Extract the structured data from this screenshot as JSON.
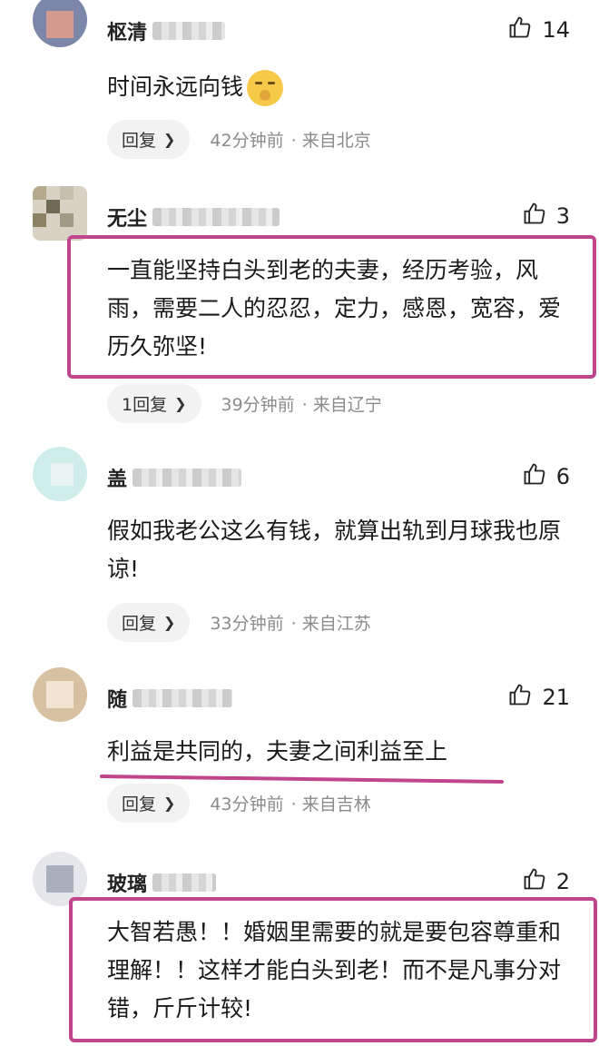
{
  "comments": [
    {
      "name_visible": "枢清",
      "likes": "14",
      "text": "时间永远向钱",
      "emoji": "shushing-face",
      "reply_label": "回复",
      "time": "42分钟前",
      "location": "· 来自北京"
    },
    {
      "name_visible": "无尘",
      "likes": "3",
      "text": "一直能坚持白头到老的夫妻，经历考验，风雨，需要二人的忍忍，定力，感恩，宽容，爱历久弥坚!",
      "reply_label": "1回复",
      "time": "39分钟前",
      "location": "· 来自辽宁"
    },
    {
      "name_visible": "盖",
      "likes": "6",
      "text": "假如我老公这么有钱，就算出轨到月球我也原谅!",
      "reply_label": "回复",
      "time": "33分钟前",
      "location": "· 来自江苏"
    },
    {
      "name_visible": "随",
      "likes": "21",
      "text": "利益是共同的，夫妻之间利益至上",
      "reply_label": "回复",
      "time": "43分钟前",
      "location": "· 来自吉林"
    },
    {
      "name_visible": "玻璃",
      "likes": "2",
      "text": "大智若愚！！婚姻里需要的就是要包容尊重和理解！！这样才能白头到老！而不是凡事分对错，斤斤计较!"
    }
  ],
  "colors": {
    "highlight": "#c0458d",
    "meta_text": "#8b8b8b",
    "reply_bg": "#f2f2f2"
  },
  "icons": [
    "thumbs-up-icon",
    "chevron-right-icon",
    "shushing-face-emoji"
  ]
}
